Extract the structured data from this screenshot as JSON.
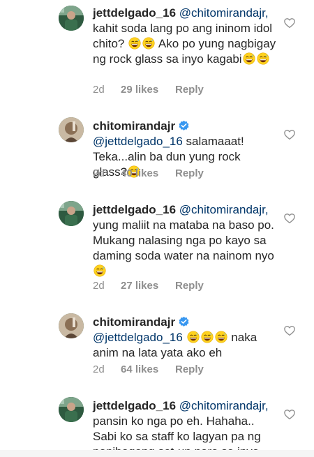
{
  "comments": [
    {
      "username": "jettdelgado_16",
      "verified": false,
      "mention": "@chitomirandajr,",
      "text_a": "kahit soda lang po ang ininom idol chito?",
      "text_b": "Ako po yung nagbigay ng rock glass sa inyo kagabi",
      "time": "2d",
      "likes": "29 likes",
      "reply": "Reply"
    },
    {
      "username": "chitomirandajr",
      "verified": true,
      "mention": "@jettdelgado_16",
      "text_a": "salamaaat! Teka...alin ba dun yung rock glass?",
      "time": "2d",
      "likes": "40 likes",
      "reply": "Reply"
    },
    {
      "username": "jettdelgado_16",
      "verified": false,
      "mention": "@chitomirandajr,",
      "text_a": "yung maliit na mataba na baso po. Mukang nalasing nga po kayo sa daming soda water na nainom nyo",
      "time": "2d",
      "likes": "27 likes",
      "reply": "Reply"
    },
    {
      "username": "chitomirandajr",
      "verified": true,
      "mention": "@jettdelgado_16",
      "text_a": "naka anim na lata yata ako eh",
      "time": "2d",
      "likes": "64 likes",
      "reply": "Reply"
    },
    {
      "username": "jettdelgado_16",
      "verified": false,
      "mention": "@chitomirandajr,",
      "text_a": "pansin ko nga po eh. Hahaha.. Sabi ko sa staff ko lagyan pa ng panibagong set-up para sa inyo"
    }
  ],
  "icons": {
    "heart": "heart-outline-icon",
    "verified": "verified-badge-icon",
    "emoji": "grinning-sweat-emoji"
  },
  "colors": {
    "mention": "#003569",
    "meta": "#8e8e8e",
    "verified": "#3897f0"
  }
}
